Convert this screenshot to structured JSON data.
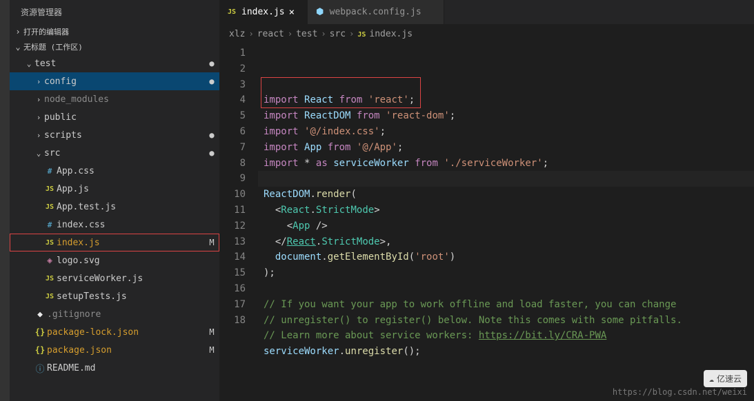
{
  "sidebar": {
    "title": "资源管理器",
    "sections": {
      "openEditors": "打开的编辑器",
      "workspace": "无标题 (工作区)"
    },
    "tree": [
      {
        "type": "folder",
        "name": "test",
        "depth": 0,
        "open": true,
        "badge": "dot-y"
      },
      {
        "type": "folder",
        "name": "config",
        "depth": 1,
        "open": false,
        "selected": true,
        "badge": "dot-b"
      },
      {
        "type": "folder",
        "name": "node_modules",
        "depth": 1,
        "open": false,
        "dim": true
      },
      {
        "type": "folder",
        "name": "public",
        "depth": 1,
        "open": false
      },
      {
        "type": "folder",
        "name": "scripts",
        "depth": 1,
        "open": false,
        "badge": "dot-g"
      },
      {
        "type": "folder",
        "name": "src",
        "depth": 1,
        "open": true,
        "badge": "dot-db"
      },
      {
        "type": "file",
        "name": "App.css",
        "depth": 2,
        "icon": "css"
      },
      {
        "type": "file",
        "name": "App.js",
        "depth": 2,
        "icon": "js"
      },
      {
        "type": "file",
        "name": "App.test.js",
        "depth": 2,
        "icon": "js"
      },
      {
        "type": "file",
        "name": "index.css",
        "depth": 2,
        "icon": "css"
      },
      {
        "type": "file",
        "name": "index.js",
        "depth": 2,
        "icon": "js",
        "git": "M",
        "hl": true
      },
      {
        "type": "file",
        "name": "logo.svg",
        "depth": 2,
        "icon": "svg"
      },
      {
        "type": "file",
        "name": "serviceWorker.js",
        "depth": 2,
        "icon": "js"
      },
      {
        "type": "file",
        "name": "setupTests.js",
        "depth": 2,
        "icon": "js"
      },
      {
        "type": "file",
        "name": ".gitignore",
        "depth": 1,
        "icon": "git",
        "dim": true
      },
      {
        "type": "file",
        "name": "package-lock.json",
        "depth": 1,
        "icon": "brace",
        "git": "M"
      },
      {
        "type": "file",
        "name": "package.json",
        "depth": 1,
        "icon": "brace",
        "git": "M"
      },
      {
        "type": "file",
        "name": "README.md",
        "depth": 1,
        "icon": "info"
      }
    ]
  },
  "tabs": [
    {
      "label": "index.js",
      "icon": "js",
      "active": true,
      "close": true
    },
    {
      "label": "webpack.config.js",
      "icon": "wp",
      "active": false,
      "close": false
    }
  ],
  "breadcrumb": [
    "xlz",
    "react",
    "test",
    "src",
    "index.js"
  ],
  "breadcrumb_icon": "JS",
  "code": {
    "lines": [
      {
        "n": 1,
        "segs": [
          [
            "kw",
            "import"
          ],
          [
            "pn",
            " "
          ],
          [
            "vr",
            "React"
          ],
          [
            "pn",
            " "
          ],
          [
            "kw",
            "from"
          ],
          [
            "pn",
            " "
          ],
          [
            "st",
            "'react'"
          ],
          [
            "pn",
            ";"
          ]
        ]
      },
      {
        "n": 2,
        "segs": [
          [
            "kw",
            "import"
          ],
          [
            "pn",
            " "
          ],
          [
            "vr",
            "ReactDOM"
          ],
          [
            "pn",
            " "
          ],
          [
            "kw",
            "from"
          ],
          [
            "pn",
            " "
          ],
          [
            "st",
            "'react-dom'"
          ],
          [
            "pn",
            ";"
          ]
        ]
      },
      {
        "n": 3,
        "segs": [
          [
            "kw",
            "import"
          ],
          [
            "pn",
            " "
          ],
          [
            "st",
            "'@/index.css'"
          ],
          [
            "pn",
            ";"
          ]
        ]
      },
      {
        "n": 4,
        "segs": [
          [
            "kw",
            "import"
          ],
          [
            "pn",
            " "
          ],
          [
            "vr",
            "App"
          ],
          [
            "pn",
            " "
          ],
          [
            "kw",
            "from"
          ],
          [
            "pn",
            " "
          ],
          [
            "st",
            "'@/App'"
          ],
          [
            "pn",
            ";"
          ]
        ]
      },
      {
        "n": 5,
        "segs": [
          [
            "kw",
            "import"
          ],
          [
            "pn",
            " "
          ],
          [
            "pn",
            "*"
          ],
          [
            "pn",
            " "
          ],
          [
            "kw",
            "as"
          ],
          [
            "pn",
            " "
          ],
          [
            "vr",
            "serviceWorker"
          ],
          [
            "pn",
            " "
          ],
          [
            "kw",
            "from"
          ],
          [
            "pn",
            " "
          ],
          [
            "st",
            "'./serviceWorker'"
          ],
          [
            "pn",
            ";"
          ]
        ]
      },
      {
        "n": 6,
        "segs": [
          [
            "pn",
            ""
          ]
        ],
        "current": true
      },
      {
        "n": 7,
        "segs": [
          [
            "vr",
            "ReactDOM"
          ],
          [
            "pn",
            "."
          ],
          [
            "fn",
            "render"
          ],
          [
            "pn",
            "("
          ]
        ]
      },
      {
        "n": 8,
        "segs": [
          [
            "pn",
            "  "
          ],
          [
            "pn",
            "<"
          ],
          [
            "tp",
            "React"
          ],
          [
            "pn",
            "."
          ],
          [
            "tp",
            "StrictMode"
          ],
          [
            "pn",
            ">"
          ]
        ]
      },
      {
        "n": 9,
        "segs": [
          [
            "pn",
            "    "
          ],
          [
            "pn",
            "<"
          ],
          [
            "tp",
            "App"
          ],
          [
            "pn",
            " />"
          ]
        ]
      },
      {
        "n": 10,
        "segs": [
          [
            "pn",
            "  "
          ],
          [
            "pn",
            "</"
          ],
          [
            "tp lnk",
            "React"
          ],
          [
            "pn",
            "."
          ],
          [
            "tp",
            "StrictMode"
          ],
          [
            "pn",
            ">,"
          ]
        ]
      },
      {
        "n": 11,
        "segs": [
          [
            "pn",
            "  "
          ],
          [
            "vr",
            "document"
          ],
          [
            "pn",
            "."
          ],
          [
            "fn",
            "getElementById"
          ],
          [
            "pn",
            "("
          ],
          [
            "st",
            "'root'"
          ],
          [
            "pn",
            ")"
          ]
        ]
      },
      {
        "n": 12,
        "segs": [
          [
            "pn",
            ");"
          ]
        ]
      },
      {
        "n": 13,
        "segs": [
          [
            "pn",
            ""
          ]
        ]
      },
      {
        "n": 14,
        "segs": [
          [
            "cm",
            "// If you want your app to work offline and load faster, you can change"
          ]
        ]
      },
      {
        "n": 15,
        "segs": [
          [
            "cm",
            "// unregister() to register() below. Note this comes with some pitfalls."
          ]
        ]
      },
      {
        "n": 16,
        "segs": [
          [
            "cm",
            "// Learn more about service workers: "
          ],
          [
            "cm lnk",
            "https://bit.ly/CRA-PWA"
          ]
        ]
      },
      {
        "n": 17,
        "segs": [
          [
            "vr",
            "serviceWorker"
          ],
          [
            "pn",
            "."
          ],
          [
            "fn",
            "unregister"
          ],
          [
            "pn",
            "();"
          ]
        ]
      },
      {
        "n": 18,
        "segs": [
          [
            "pn",
            ""
          ]
        ]
      }
    ]
  },
  "watermark": "https://blog.csdn.net/weixi",
  "cloud_label": "亿速云"
}
